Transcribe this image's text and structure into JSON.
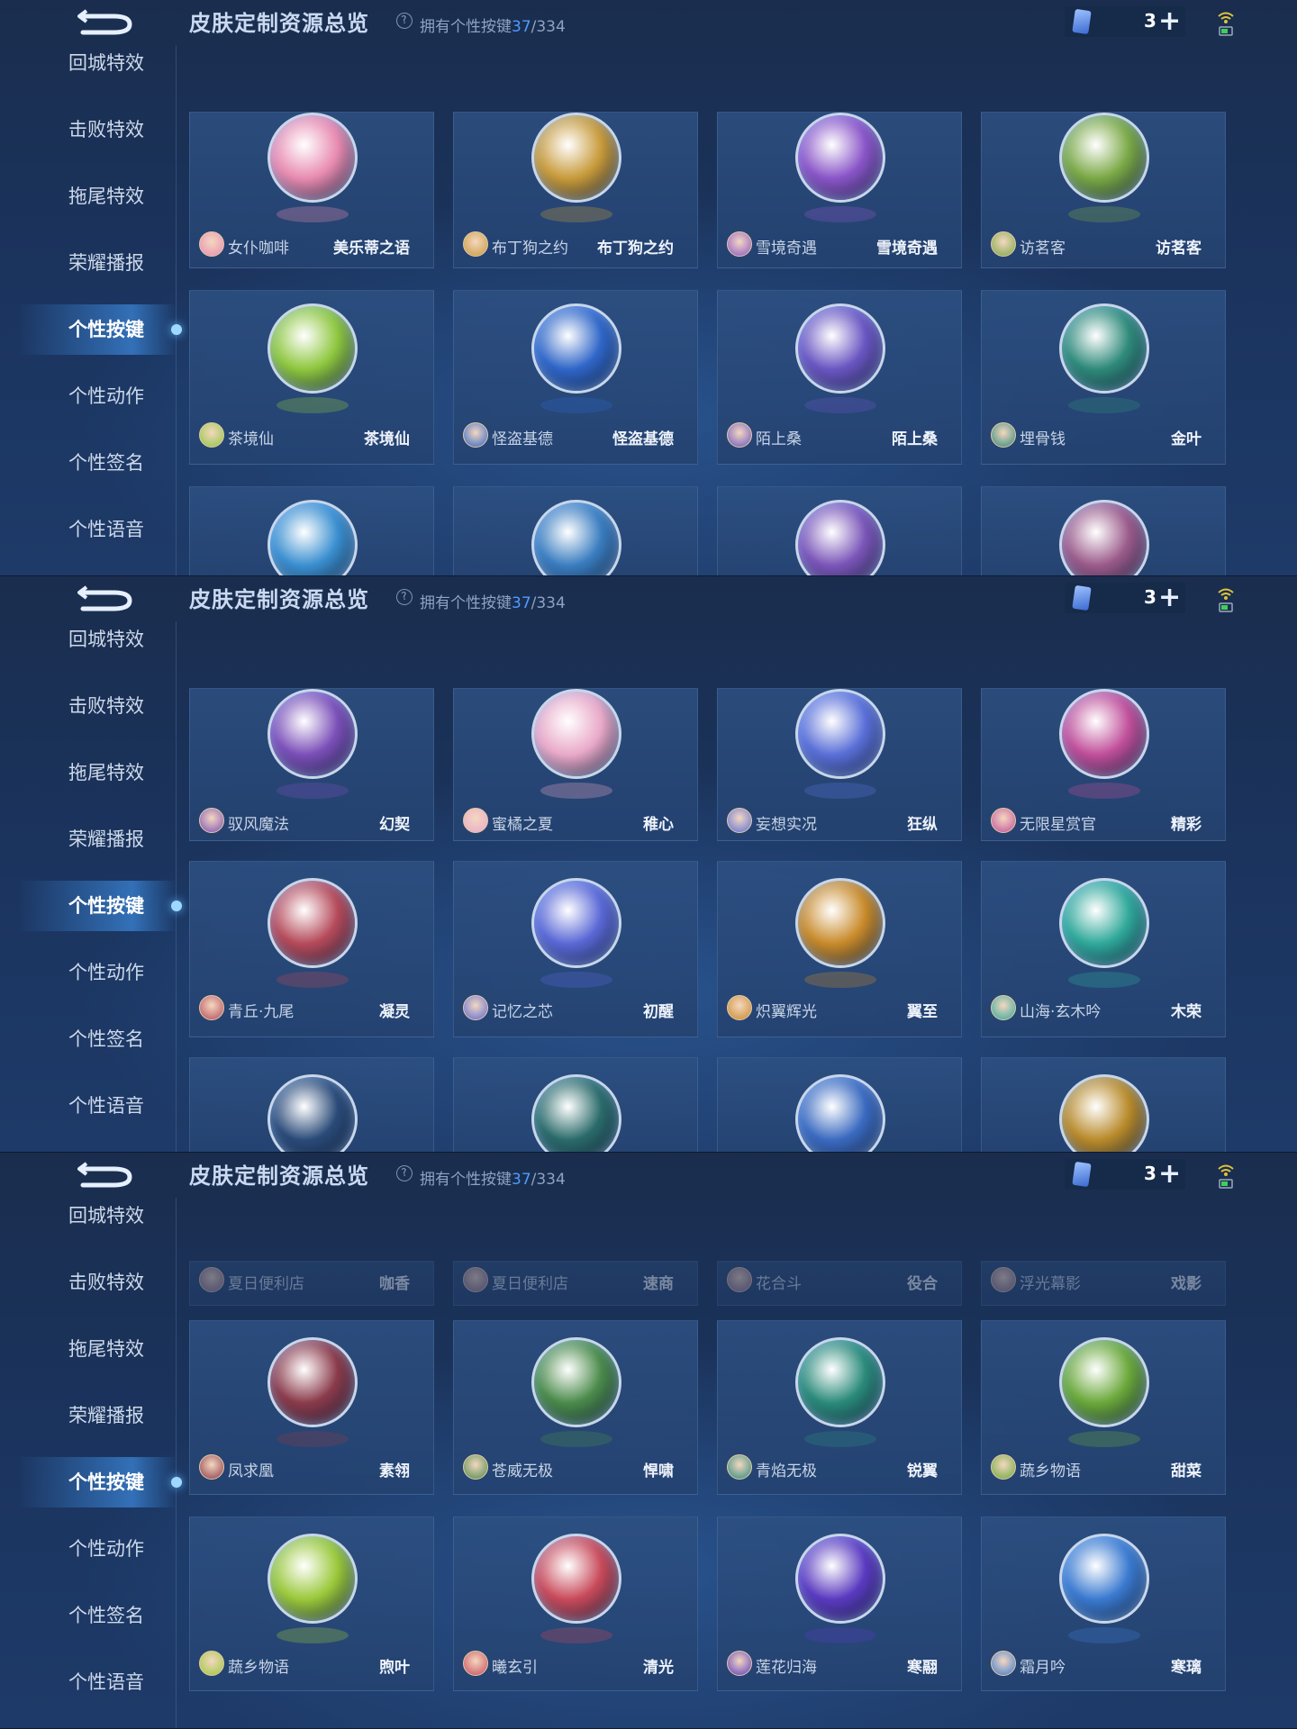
{
  "header": {
    "title": "皮肤定制资源总览",
    "help_icon": "?",
    "owned_prefix": "拥有个性按键",
    "owned_count": "37",
    "owned_total": "/334",
    "currency_value": "3",
    "plus": "+"
  },
  "sidebar": {
    "items": [
      "回城特效",
      "击败特效",
      "拖尾特效",
      "荣耀播报",
      "个性按键",
      "个性动作",
      "个性签名",
      "个性语音"
    ],
    "active": "个性按键"
  },
  "screens": [
    {
      "rows": [
        [
          {
            "skin": "女仆咖啡",
            "name": "美乐蒂之语",
            "color": "#e88bb0"
          },
          {
            "skin": "布丁狗之约",
            "name": "布丁狗之约",
            "color": "#c79a3a"
          },
          {
            "skin": "雪境奇遇",
            "name": "雪境奇遇",
            "color": "#8a55c8"
          },
          {
            "skin": "访茗客",
            "name": "访茗客",
            "color": "#7aa845"
          }
        ],
        [
          {
            "skin": "茶境仙",
            "name": "茶境仙",
            "color": "#8ec73f"
          },
          {
            "skin": "怪盗基德",
            "name": "怪盗基德",
            "color": "#2f66c8"
          },
          {
            "skin": "陌上桑",
            "name": "陌上桑",
            "color": "#6a56c2"
          },
          {
            "skin": "埋骨钱",
            "name": "金叶",
            "color": "#2e8a7a"
          }
        ],
        [
          {
            "color": "#3a8fd0"
          },
          {
            "color": "#3a7dc0"
          },
          {
            "color": "#7a55b8"
          },
          {
            "color": "#9a5a8a"
          }
        ]
      ]
    },
    {
      "rows": [
        [
          {
            "skin": "驭风魔法",
            "name": "幻契",
            "color": "#7b4fb8"
          },
          {
            "skin": "蜜橘之夏",
            "name": "稚心",
            "color": "#e9a9c8"
          },
          {
            "skin": "妄想实况",
            "name": "狂纵",
            "color": "#5a6fd8"
          },
          {
            "skin": "无限星赏官",
            "name": "精彩",
            "color": "#c04f9a"
          }
        ],
        [
          {
            "skin": "青丘·九尾",
            "name": "凝灵",
            "color": "#b54a5a"
          },
          {
            "skin": "记忆之芯",
            "name": "初醒",
            "color": "#5a68d6"
          },
          {
            "skin": "炽翼辉光",
            "name": "翼至",
            "color": "#c88a2a"
          },
          {
            "skin": "山海·玄木吟",
            "name": "木荣",
            "color": "#2fa89a"
          }
        ],
        [
          {
            "color": "#2a4a78"
          },
          {
            "color": "#2a6a6a"
          },
          {
            "color": "#3a6ac0"
          },
          {
            "color": "#b88a2a"
          }
        ]
      ]
    },
    {
      "rows": [
        [
          {
            "skin": "夏日便利店",
            "name": "咖香"
          },
          {
            "skin": "夏日便利店",
            "name": "速商"
          },
          {
            "skin": "花合斗",
            "name": "役合"
          },
          {
            "skin": "浮光幕影",
            "name": "戏影"
          }
        ],
        [
          {
            "skin": "凤求凰",
            "name": "素翎",
            "color": "#8a3a4a"
          },
          {
            "skin": "苍威无极",
            "name": "悍啸",
            "color": "#4a8a4a"
          },
          {
            "skin": "青焰无极",
            "name": "锐翼",
            "color": "#2a8a7a"
          },
          {
            "skin": "蔬乡物语",
            "name": "甜菜",
            "color": "#6aa83a"
          }
        ],
        [
          {
            "skin": "蔬乡物语",
            "name": "煦叶",
            "color": "#9ac83a"
          },
          {
            "skin": "曦玄引",
            "name": "清光",
            "color": "#c84a5a"
          },
          {
            "skin": "莲花归海",
            "name": "寒翮",
            "color": "#5a3ac0"
          },
          {
            "skin": "霜月吟",
            "name": "寒璃",
            "color": "#3a7ad0"
          }
        ]
      ]
    }
  ]
}
